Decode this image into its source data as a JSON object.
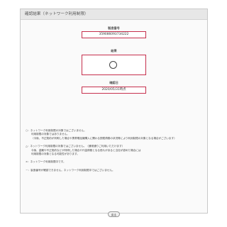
{
  "panel": {
    "title": "確認結果（ネットワーク利用制限）"
  },
  "fields": {
    "serial_label": "製造番号",
    "serial_value": "359086093734222",
    "result_label": "結果",
    "result_symbol": "○",
    "date_label": "確認日",
    "date_value": "2020/05/31時点"
  },
  "legend": {
    "circle_head": "○：ネットワーク利用制限の対象ではございません。",
    "circle_sub1": "利用制限の対象ではありません。",
    "circle_sub2": "（今後、不正契約が判明した場合や携帯電話機購入に関わる割賦債務の状況等により利用制限の対象となる場合がございます）",
    "triangle_head": "△：ネットワーク利用制限の対象ではございません。（通常通りご利用いただけます）",
    "triangle_sub1": "今後、盗難や不正契約などが判明した場合や代金債務となる恐れがあると当社が認めた場合には",
    "triangle_sub2": "利用制限の対象となる可能性があります。",
    "cross_head": "×：ネットワーク利用制限中です。",
    "dash_head": "－：製造番号が確認できません。ネットワーク利用制限中ではございません。"
  },
  "buttons": {
    "back_label": "戻る"
  }
}
